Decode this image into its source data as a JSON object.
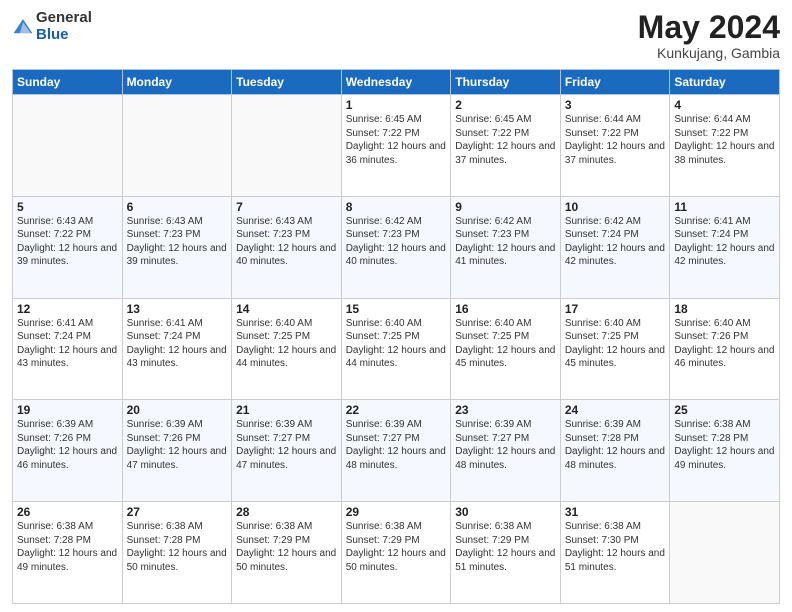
{
  "header": {
    "logo_general": "General",
    "logo_blue": "Blue",
    "month": "May 2024",
    "location": "Kunkujang, Gambia"
  },
  "weekdays": [
    "Sunday",
    "Monday",
    "Tuesday",
    "Wednesday",
    "Thursday",
    "Friday",
    "Saturday"
  ],
  "weeks": [
    [
      {
        "day": "",
        "info": ""
      },
      {
        "day": "",
        "info": ""
      },
      {
        "day": "",
        "info": ""
      },
      {
        "day": "1",
        "info": "Sunrise: 6:45 AM\nSunset: 7:22 PM\nDaylight: 12 hours and 36 minutes."
      },
      {
        "day": "2",
        "info": "Sunrise: 6:45 AM\nSunset: 7:22 PM\nDaylight: 12 hours and 37 minutes."
      },
      {
        "day": "3",
        "info": "Sunrise: 6:44 AM\nSunset: 7:22 PM\nDaylight: 12 hours and 37 minutes."
      },
      {
        "day": "4",
        "info": "Sunrise: 6:44 AM\nSunset: 7:22 PM\nDaylight: 12 hours and 38 minutes."
      }
    ],
    [
      {
        "day": "5",
        "info": "Sunrise: 6:43 AM\nSunset: 7:22 PM\nDaylight: 12 hours and 39 minutes."
      },
      {
        "day": "6",
        "info": "Sunrise: 6:43 AM\nSunset: 7:23 PM\nDaylight: 12 hours and 39 minutes."
      },
      {
        "day": "7",
        "info": "Sunrise: 6:43 AM\nSunset: 7:23 PM\nDaylight: 12 hours and 40 minutes."
      },
      {
        "day": "8",
        "info": "Sunrise: 6:42 AM\nSunset: 7:23 PM\nDaylight: 12 hours and 40 minutes."
      },
      {
        "day": "9",
        "info": "Sunrise: 6:42 AM\nSunset: 7:23 PM\nDaylight: 12 hours and 41 minutes."
      },
      {
        "day": "10",
        "info": "Sunrise: 6:42 AM\nSunset: 7:24 PM\nDaylight: 12 hours and 42 minutes."
      },
      {
        "day": "11",
        "info": "Sunrise: 6:41 AM\nSunset: 7:24 PM\nDaylight: 12 hours and 42 minutes."
      }
    ],
    [
      {
        "day": "12",
        "info": "Sunrise: 6:41 AM\nSunset: 7:24 PM\nDaylight: 12 hours and 43 minutes."
      },
      {
        "day": "13",
        "info": "Sunrise: 6:41 AM\nSunset: 7:24 PM\nDaylight: 12 hours and 43 minutes."
      },
      {
        "day": "14",
        "info": "Sunrise: 6:40 AM\nSunset: 7:25 PM\nDaylight: 12 hours and 44 minutes."
      },
      {
        "day": "15",
        "info": "Sunrise: 6:40 AM\nSunset: 7:25 PM\nDaylight: 12 hours and 44 minutes."
      },
      {
        "day": "16",
        "info": "Sunrise: 6:40 AM\nSunset: 7:25 PM\nDaylight: 12 hours and 45 minutes."
      },
      {
        "day": "17",
        "info": "Sunrise: 6:40 AM\nSunset: 7:25 PM\nDaylight: 12 hours and 45 minutes."
      },
      {
        "day": "18",
        "info": "Sunrise: 6:40 AM\nSunset: 7:26 PM\nDaylight: 12 hours and 46 minutes."
      }
    ],
    [
      {
        "day": "19",
        "info": "Sunrise: 6:39 AM\nSunset: 7:26 PM\nDaylight: 12 hours and 46 minutes."
      },
      {
        "day": "20",
        "info": "Sunrise: 6:39 AM\nSunset: 7:26 PM\nDaylight: 12 hours and 47 minutes."
      },
      {
        "day": "21",
        "info": "Sunrise: 6:39 AM\nSunset: 7:27 PM\nDaylight: 12 hours and 47 minutes."
      },
      {
        "day": "22",
        "info": "Sunrise: 6:39 AM\nSunset: 7:27 PM\nDaylight: 12 hours and 48 minutes."
      },
      {
        "day": "23",
        "info": "Sunrise: 6:39 AM\nSunset: 7:27 PM\nDaylight: 12 hours and 48 minutes."
      },
      {
        "day": "24",
        "info": "Sunrise: 6:39 AM\nSunset: 7:28 PM\nDaylight: 12 hours and 48 minutes."
      },
      {
        "day": "25",
        "info": "Sunrise: 6:38 AM\nSunset: 7:28 PM\nDaylight: 12 hours and 49 minutes."
      }
    ],
    [
      {
        "day": "26",
        "info": "Sunrise: 6:38 AM\nSunset: 7:28 PM\nDaylight: 12 hours and 49 minutes."
      },
      {
        "day": "27",
        "info": "Sunrise: 6:38 AM\nSunset: 7:28 PM\nDaylight: 12 hours and 50 minutes."
      },
      {
        "day": "28",
        "info": "Sunrise: 6:38 AM\nSunset: 7:29 PM\nDaylight: 12 hours and 50 minutes."
      },
      {
        "day": "29",
        "info": "Sunrise: 6:38 AM\nSunset: 7:29 PM\nDaylight: 12 hours and 50 minutes."
      },
      {
        "day": "30",
        "info": "Sunrise: 6:38 AM\nSunset: 7:29 PM\nDaylight: 12 hours and 51 minutes."
      },
      {
        "day": "31",
        "info": "Sunrise: 6:38 AM\nSunset: 7:30 PM\nDaylight: 12 hours and 51 minutes."
      },
      {
        "day": "",
        "info": ""
      }
    ]
  ]
}
